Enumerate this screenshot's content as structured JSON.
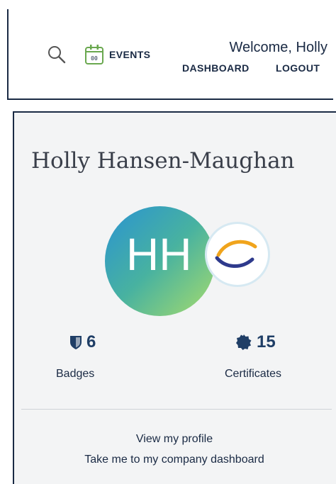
{
  "header": {
    "events_label": "EVENTS",
    "calendar_day": "00",
    "welcome_text": "Welcome, Holly",
    "dashboard_label": "DASHBOARD",
    "logout_label": "LOGOUT"
  },
  "profile": {
    "name": "Holly Hansen-Maughan",
    "initials": "HH",
    "badges_count": "6",
    "badges_label": "Badges",
    "certificates_count": "15",
    "certificates_label": "Certificates",
    "view_profile_link": "View my profile",
    "company_dashboard_link": "Take me to my company dashboard"
  },
  "icons": {
    "search": "search-icon",
    "events": "calendar-icon",
    "badges": "shield-icon",
    "certificates": "certificate-seal-icon",
    "logo": "swoosh-logo-icon"
  },
  "colors": {
    "navy": "#1a2a44",
    "stat_blue": "#1f3e66",
    "card_background": "#f3f4f5",
    "avatar_gradient_start": "#2a93d2",
    "avatar_gradient_end": "#a7dc6c"
  }
}
